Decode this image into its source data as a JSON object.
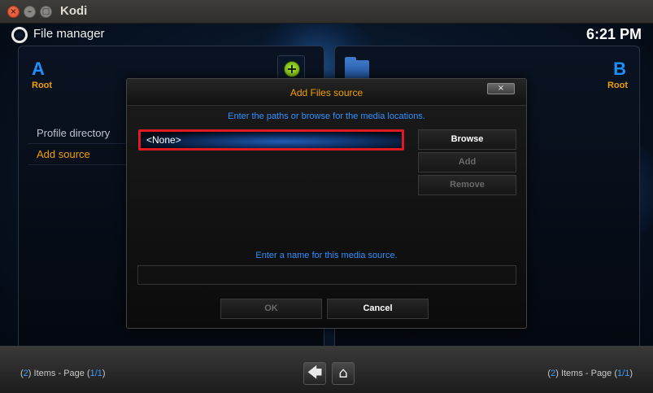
{
  "window": {
    "title": "Kodi",
    "close_glyph": "×",
    "minimize_glyph": "–",
    "maximize_glyph": "□"
  },
  "header": {
    "title": "File manager",
    "clock": "6:21 PM"
  },
  "left_panel": {
    "letter": "A",
    "location": "Root",
    "items": [
      {
        "label": "Profile directory"
      },
      {
        "label": "Add source"
      }
    ]
  },
  "right_panel": {
    "letter": "B",
    "location": "Root"
  },
  "dialog": {
    "title": "Add Files source",
    "close_glyph": "×",
    "paths_hint": "Enter the paths or browse for the media locations.",
    "path_value": "<None>",
    "browse_label": "Browse",
    "add_label": "Add",
    "remove_label": "Remove",
    "name_hint": "Enter a name for this media source.",
    "name_value": "",
    "ok_label": "OK",
    "cancel_label": "Cancel"
  },
  "footer": {
    "left": {
      "count": "2",
      "items_text": "Items - Page",
      "page": "1/1"
    },
    "right": {
      "count": "2",
      "items_text": "Items - Page",
      "page": "1/1"
    },
    "back_glyph": "🡄",
    "home_glyph": "⌂"
  },
  "colors": {
    "accent_orange": "#f0a000",
    "accent_blue": "#1e8fff",
    "highlight_red": "#e01a22"
  }
}
